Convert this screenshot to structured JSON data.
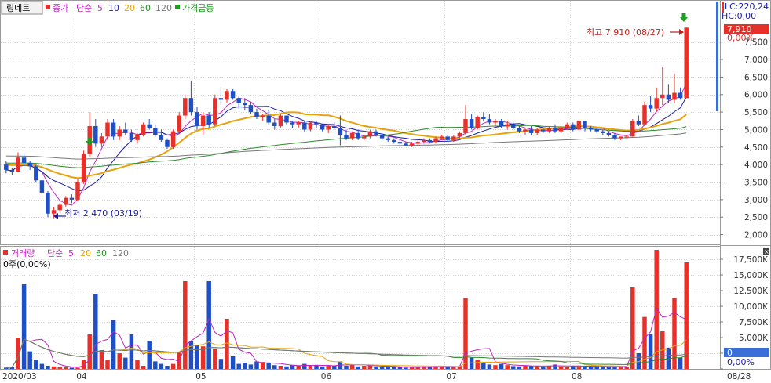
{
  "price_legend": {
    "stock_name": "링네트",
    "close_label": "종가",
    "ma_label": "단순",
    "ma_periods": [
      "5",
      "10",
      "20",
      "60",
      "120"
    ],
    "signal_label": "가격급등"
  },
  "volume_legend": {
    "title": "거래량",
    "ma_label": "단순",
    "ma_periods": [
      "5",
      "20",
      "60",
      "120"
    ],
    "status": "0주(0,00%)"
  },
  "right_panel": {
    "lc": "LC:220,24",
    "hc": "HC:0,00",
    "current_price": "7,910",
    "current_pct": "0,00%",
    "volume_current": "0",
    "volume_pct": "0,00%"
  },
  "annotations": {
    "high": "최고 7,910 (08/27)",
    "low": "최저 2,470 (03/19)"
  },
  "colors": {
    "up": "#e8302a",
    "down": "#1f4fc7",
    "ma5": "#c026c0",
    "ma10": "#1a1aa8",
    "ma20": "#e8a20a",
    "ma60": "#2e8b2e",
    "ma120": "#777777",
    "signal": "#1e9e1e"
  },
  "chart_data": [
    {
      "type": "candlestick",
      "title": "링네트",
      "y_ticks": [
        "2,000",
        "2,500",
        "3,000",
        "3,500",
        "4,000",
        "4,500",
        "5,000",
        "5,500",
        "6,000",
        "6,500",
        "7,000",
        "7,500"
      ],
      "ylim": [
        1700,
        8700
      ],
      "x_ticks": [
        "2020/03",
        "04",
        "05",
        "06",
        "07",
        "08",
        "08/28"
      ],
      "grid": true,
      "high": 7910,
      "low": 2470,
      "ohlc": [
        [
          4000,
          4100,
          3750,
          3850
        ],
        [
          3850,
          3900,
          3700,
          3800
        ],
        [
          3800,
          4350,
          3800,
          4200
        ],
        [
          4200,
          4300,
          3950,
          4050
        ],
        [
          4050,
          4100,
          3850,
          3950
        ],
        [
          3950,
          4000,
          3500,
          3550
        ],
        [
          3550,
          3600,
          3150,
          3200
        ],
        [
          3200,
          3250,
          2500,
          2600
        ],
        [
          2600,
          2800,
          2470,
          2700
        ],
        [
          2700,
          2900,
          2650,
          2850
        ],
        [
          2850,
          3100,
          2800,
          3050
        ],
        [
          3050,
          3150,
          2900,
          3000
        ],
        [
          3000,
          3600,
          2950,
          3500
        ],
        [
          3500,
          4400,
          3450,
          4300
        ],
        [
          4300,
          5500,
          4200,
          5100
        ],
        [
          5100,
          5300,
          4500,
          4600
        ],
        [
          4600,
          4900,
          4500,
          4800
        ],
        [
          4800,
          5300,
          4700,
          5200
        ],
        [
          5200,
          5300,
          4700,
          4800
        ],
        [
          4800,
          5100,
          4700,
          5000
        ],
        [
          5000,
          5200,
          4850,
          4900
        ],
        [
          4900,
          5000,
          4650,
          4700
        ],
        [
          4700,
          4900,
          4600,
          4850
        ],
        [
          4850,
          5200,
          4800,
          5150
        ],
        [
          5150,
          5300,
          5000,
          5050
        ],
        [
          5050,
          5150,
          4800,
          4850
        ],
        [
          4850,
          5000,
          4650,
          4700
        ],
        [
          4700,
          4750,
          4450,
          4500
        ],
        [
          4500,
          5000,
          4450,
          4950
        ],
        [
          4950,
          5500,
          4900,
          5400
        ],
        [
          5400,
          6000,
          5300,
          5900
        ],
        [
          5900,
          6400,
          5400,
          5500
        ],
        [
          5500,
          5650,
          5000,
          5100
        ],
        [
          5100,
          5500,
          4850,
          5400
        ],
        [
          5400,
          5500,
          5050,
          5150
        ],
        [
          5150,
          6000,
          5100,
          5900
        ],
        [
          5900,
          6200,
          5700,
          5850
        ],
        [
          5850,
          6150,
          5750,
          6100
        ],
        [
          6100,
          6150,
          5850,
          5900
        ],
        [
          5900,
          5950,
          5600,
          5750
        ],
        [
          5750,
          5900,
          5550,
          5700
        ],
        [
          5700,
          5800,
          5450,
          5500
        ],
        [
          5500,
          5600,
          5300,
          5350
        ],
        [
          5350,
          5450,
          5250,
          5400
        ],
        [
          5400,
          5550,
          5150,
          5200
        ],
        [
          5200,
          5300,
          5000,
          5100
        ],
        [
          5100,
          5450,
          5050,
          5400
        ],
        [
          5400,
          5400,
          5150,
          5200
        ],
        [
          5200,
          5250,
          5050,
          5150
        ],
        [
          5150,
          5250,
          5050,
          5200
        ],
        [
          5200,
          5250,
          4950,
          5000
        ],
        [
          5000,
          5250,
          4950,
          5200
        ],
        [
          5200,
          5250,
          5050,
          5150
        ],
        [
          5150,
          5150,
          4950,
          5000
        ],
        [
          5000,
          5150,
          4900,
          5100
        ],
        [
          5100,
          5200,
          5000,
          5050
        ],
        [
          5050,
          5400,
          4550,
          4850
        ],
        [
          4850,
          5000,
          4700,
          4750
        ],
        [
          4750,
          4950,
          4700,
          4900
        ],
        [
          4900,
          5000,
          4700,
          4750
        ],
        [
          4750,
          4850,
          4700,
          4800
        ],
        [
          4800,
          5000,
          4750,
          4950
        ],
        [
          4950,
          5000,
          4800,
          4850
        ],
        [
          4850,
          4900,
          4700,
          4750
        ],
        [
          4750,
          4800,
          4650,
          4700
        ],
        [
          4700,
          4750,
          4600,
          4650
        ],
        [
          4650,
          4700,
          4550,
          4600
        ],
        [
          4600,
          4650,
          4520,
          4550
        ],
        [
          4550,
          4650,
          4500,
          4600
        ],
        [
          4600,
          4700,
          4550,
          4650
        ],
        [
          4650,
          4750,
          4600,
          4700
        ],
        [
          4700,
          4750,
          4600,
          4650
        ],
        [
          4650,
          4800,
          4600,
          4750
        ],
        [
          4750,
          4850,
          4700,
          4800
        ],
        [
          4800,
          4850,
          4650,
          4700
        ],
        [
          4700,
          4850,
          4650,
          4800
        ],
        [
          4800,
          4950,
          4750,
          4900
        ],
        [
          4900,
          5700,
          4850,
          5300
        ],
        [
          5300,
          5450,
          5000,
          5050
        ],
        [
          5050,
          5400,
          5000,
          5350
        ],
        [
          5350,
          5500,
          5250,
          5300
        ],
        [
          5300,
          5450,
          5150,
          5200
        ],
        [
          5200,
          5300,
          5100,
          5250
        ],
        [
          5250,
          5300,
          5050,
          5100
        ],
        [
          5100,
          5250,
          5000,
          5150
        ],
        [
          5150,
          5200,
          5000,
          5050
        ],
        [
          5050,
          5100,
          4900,
          4950
        ],
        [
          4950,
          5050,
          4850,
          5000
        ],
        [
          5000,
          5100,
          4850,
          4900
        ],
        [
          4900,
          5050,
          4850,
          5000
        ],
        [
          5000,
          5050,
          4900,
          4950
        ],
        [
          4950,
          5100,
          4900,
          5050
        ],
        [
          5050,
          5150,
          4900,
          4950
        ],
        [
          4950,
          5100,
          4900,
          5050
        ],
        [
          5050,
          5200,
          5000,
          5150
        ],
        [
          5150,
          5200,
          4950,
          5000
        ],
        [
          5000,
          5300,
          4950,
          5250
        ],
        [
          5250,
          5250,
          4950,
          5050
        ],
        [
          5050,
          5100,
          4950,
          5000
        ],
        [
          5000,
          5050,
          4900,
          4950
        ],
        [
          4950,
          5000,
          4850,
          4900
        ],
        [
          4900,
          4950,
          4800,
          4850
        ],
        [
          4850,
          4900,
          4700,
          4750
        ],
        [
          4750,
          4800,
          4700,
          4800
        ],
        [
          4800,
          4850,
          4750,
          4800
        ],
        [
          4800,
          5300,
          4800,
          5250
        ],
        [
          5250,
          5400,
          5100,
          5150
        ],
        [
          5150,
          5800,
          5100,
          5700
        ],
        [
          5700,
          5950,
          5500,
          5600
        ],
        [
          5600,
          6200,
          5500,
          5900
        ],
        [
          5900,
          6800,
          5700,
          6000
        ],
        [
          6000,
          6300,
          5750,
          5850
        ],
        [
          5850,
          6600,
          5750,
          6050
        ],
        [
          6050,
          6200,
          5850,
          5900
        ],
        [
          5900,
          7910,
          5900,
          7910
        ]
      ]
    },
    {
      "type": "bar",
      "title": "거래량",
      "y_ticks": [
        "0",
        "2,500K",
        "5,000K",
        "7,500K",
        "10,000K",
        "12,500K",
        "15,000K",
        "17,500K"
      ],
      "ylim": [
        0,
        19500
      ],
      "volume_k": [
        200,
        350,
        5000,
        13500,
        2800,
        1500,
        800,
        500,
        400,
        300,
        250,
        200,
        200,
        1500,
        5500,
        12000,
        3000,
        1500,
        7800,
        2500,
        1800,
        5500,
        1500,
        500,
        4500,
        1200,
        800,
        500,
        800,
        2600,
        14000,
        4500,
        3800,
        3600,
        14000,
        3200,
        1600,
        8000,
        2000,
        800,
        1000,
        700,
        1200,
        1100,
        900,
        600,
        500,
        400,
        600,
        500,
        800,
        500,
        600,
        400,
        500,
        500,
        1200,
        500,
        700,
        400,
        500,
        600,
        400,
        300,
        400,
        300,
        250,
        200,
        300,
        250,
        400,
        300,
        500,
        400,
        300,
        250,
        450,
        11300,
        1800,
        1500,
        1000,
        700,
        600,
        800,
        600,
        450,
        400,
        500,
        500,
        450,
        400,
        500,
        700,
        400,
        300,
        500,
        500,
        500,
        400,
        450,
        300,
        400,
        400,
        300,
        300,
        13000,
        2500,
        8300,
        5500,
        19000,
        6000,
        3400,
        11300,
        1800,
        17000
      ]
    }
  ]
}
